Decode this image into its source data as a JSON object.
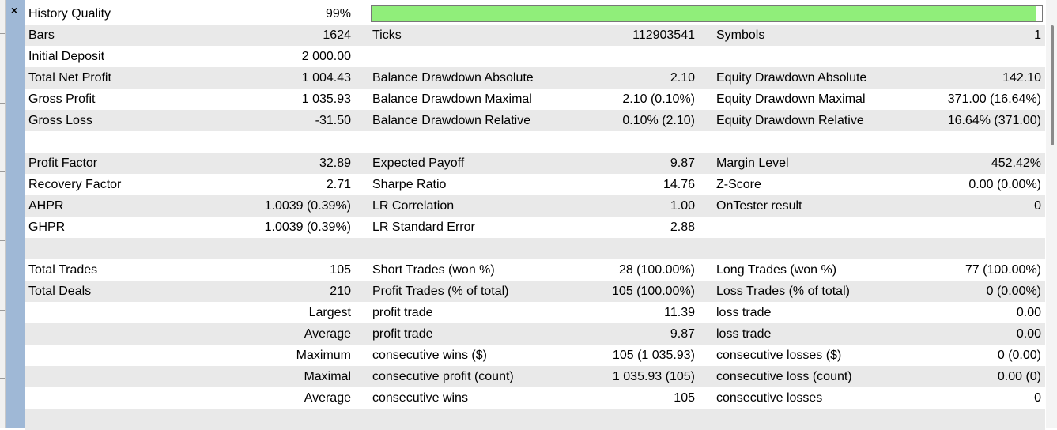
{
  "close_symbol": "×",
  "history_quality": {
    "label": "History Quality",
    "value": "99%",
    "fill_fraction": 0.99,
    "bar_color": "#90ee7a"
  },
  "rows": [
    {
      "l1": "Bars",
      "v1": "1624",
      "l2": "Ticks",
      "v2": "112903541",
      "l3": "Symbols",
      "v3": "1"
    },
    {
      "l1": "Initial Deposit",
      "v1": "2 000.00",
      "l2": "",
      "v2": "",
      "l3": "",
      "v3": ""
    },
    {
      "l1": "Total Net Profit",
      "v1": "1 004.43",
      "l2": "Balance Drawdown Absolute",
      "v2": "2.10",
      "l3": "Equity Drawdown Absolute",
      "v3": "142.10"
    },
    {
      "l1": "Gross Profit",
      "v1": "1 035.93",
      "l2": "Balance Drawdown Maximal",
      "v2": "2.10 (0.10%)",
      "l3": "Equity Drawdown Maximal",
      "v3": "371.00 (16.64%)"
    },
    {
      "l1": "Gross Loss",
      "v1": "-31.50",
      "l2": "Balance Drawdown Relative",
      "v2": "0.10% (2.10)",
      "l3": "Equity Drawdown Relative",
      "v3": "16.64% (371.00)"
    },
    {
      "l1": "",
      "v1": "",
      "l2": "",
      "v2": "",
      "l3": "",
      "v3": ""
    },
    {
      "l1": "Profit Factor",
      "v1": "32.89",
      "l2": "Expected Payoff",
      "v2": "9.87",
      "l3": "Margin Level",
      "v3": "452.42%"
    },
    {
      "l1": "Recovery Factor",
      "v1": "2.71",
      "l2": "Sharpe Ratio",
      "v2": "14.76",
      "l3": "Z-Score",
      "v3": "0.00 (0.00%)"
    },
    {
      "l1": "AHPR",
      "v1": "1.0039 (0.39%)",
      "l2": "LR Correlation",
      "v2": "1.00",
      "l3": "OnTester result",
      "v3": "0"
    },
    {
      "l1": "GHPR",
      "v1": "1.0039 (0.39%)",
      "l2": "LR Standard Error",
      "v2": "2.88",
      "l3": "",
      "v3": ""
    },
    {
      "l1": "",
      "v1": "",
      "l2": "",
      "v2": "",
      "l3": "",
      "v3": ""
    },
    {
      "l1": "Total Trades",
      "v1": "105",
      "l2": "Short Trades (won %)",
      "v2": "28 (100.00%)",
      "l3": "Long Trades (won %)",
      "v3": "77 (100.00%)"
    },
    {
      "l1": "Total Deals",
      "v1": "210",
      "l2": "Profit Trades (% of total)",
      "v2": "105 (100.00%)",
      "l3": "Loss Trades (% of total)",
      "v3": "0 (0.00%)"
    },
    {
      "l1": "",
      "v1": "Largest",
      "l2": "profit trade",
      "v2": "11.39",
      "l3": "loss trade",
      "v3": "0.00"
    },
    {
      "l1": "",
      "v1": "Average",
      "l2": "profit trade",
      "v2": "9.87",
      "l3": "loss trade",
      "v3": "0.00"
    },
    {
      "l1": "",
      "v1": "Maximum",
      "l2": "consecutive wins ($)",
      "v2": "105 (1 035.93)",
      "l3": "consecutive losses ($)",
      "v3": "0 (0.00)"
    },
    {
      "l1": "",
      "v1": "Maximal",
      "l2": "consecutive profit (count)",
      "v2": "1 035.93 (105)",
      "l3": "consecutive loss (count)",
      "v3": "0.00 (0)"
    },
    {
      "l1": "",
      "v1": "Average",
      "l2": "consecutive wins",
      "v2": "105",
      "l3": "consecutive losses",
      "v3": "0"
    },
    {
      "l1": "",
      "v1": "",
      "l2": "",
      "v2": "",
      "l3": "",
      "v3": ""
    }
  ]
}
